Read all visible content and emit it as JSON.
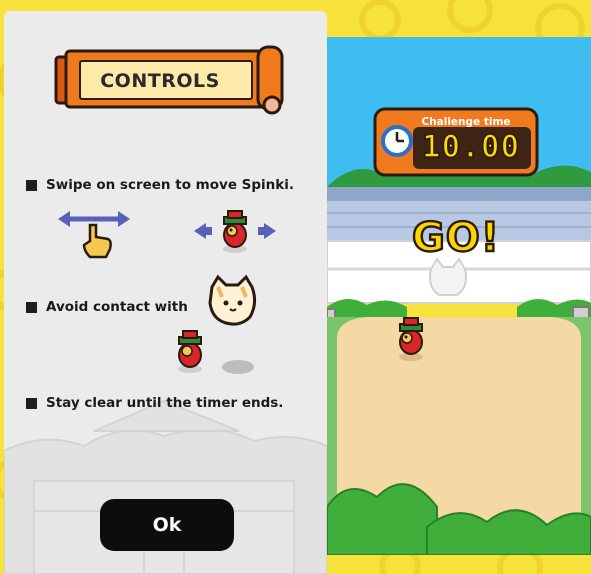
{
  "controls_panel": {
    "title": "CONTROLS",
    "rules": [
      {
        "text": "Swipe on screen to move Spinki."
      },
      {
        "text": "Avoid contact with"
      },
      {
        "text": "Stay clear until the timer ends."
      }
    ],
    "ok_label": "Ok"
  },
  "game": {
    "timer_label": "Challenge time",
    "timer_value": "10.00",
    "go_text": "GO!"
  },
  "colors": {
    "backdrop": "#f6e23a",
    "panel": "#ebebeb",
    "banner": "#f07a1e",
    "timer_box": "#f07a1e",
    "timer_digits": "#ffd900",
    "sky": "#3fbcf0",
    "ground": "#f4d9a5",
    "bush": "#3fae3a",
    "ok_button": "#0d0d0d"
  },
  "icons": [
    "clock-icon",
    "swipe-hand-icon",
    "arrow-left-icon",
    "arrow-right-icon",
    "spinki-character",
    "cat-ghost-enemy"
  ]
}
